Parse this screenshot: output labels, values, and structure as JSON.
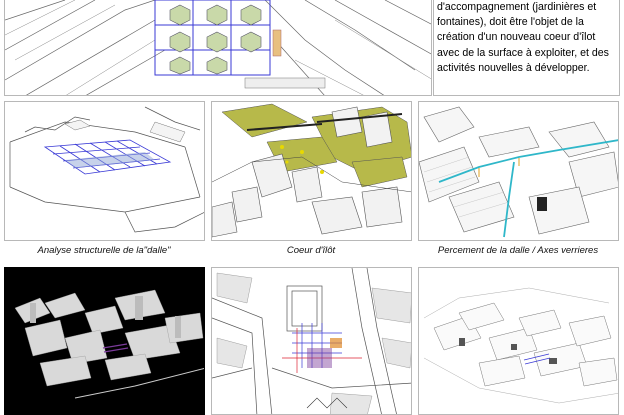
{
  "description_text": {
    "lines": [
      "d'accompagnement (jardinières et",
      "fontaines), doit être l'objet de la",
      "création d'un nouveau coeur d'îlot",
      "avec de la surface à exploiter, et des",
      "activités nouvelles à  développer."
    ]
  },
  "captions": {
    "structural": "Analyse structurelle de la\"dalle\"",
    "core": "Coeur d'îlôt",
    "perforation": "Percement de la dalle / Axes verrieres"
  },
  "colors": {
    "line": "#555555",
    "blue_grid": "#3a3ad6",
    "green_fill": "#b7b94a",
    "green_light": "#c9d9a9",
    "cyan": "#2fb7c9",
    "dark_panel": "#000000",
    "purple": "#7a3a9a",
    "orange": "#e08a2a"
  }
}
